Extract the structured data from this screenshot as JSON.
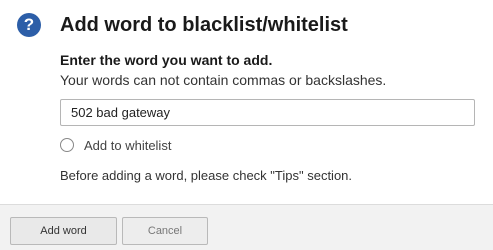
{
  "dialog": {
    "title": "Add word to blacklist/whitelist",
    "help_glyph": "?",
    "prompt": "Enter the word you want to add.",
    "hint": "Your words can not contain commas or backslashes.",
    "word_input": {
      "value": "502 bad gateway",
      "placeholder": ""
    },
    "whitelist": {
      "label": "Add to whitelist",
      "selected": false
    },
    "tips_note": "Before adding a word, please check \"Tips\" section."
  },
  "footer": {
    "add_label": "Add word",
    "cancel_label": "Cancel"
  },
  "colors": {
    "help_icon": "#2c5ea8",
    "footer_bg": "#f2f2f2",
    "button_bg": "#e9e9e9"
  }
}
